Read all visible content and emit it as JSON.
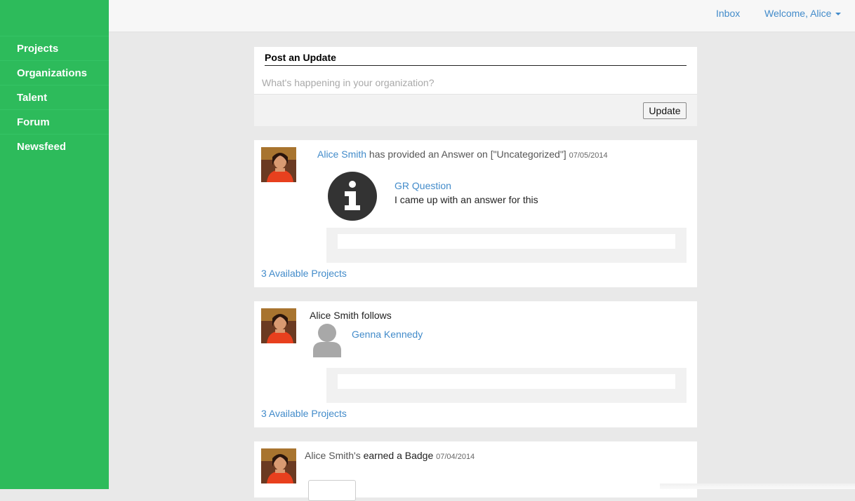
{
  "sidebar": {
    "items": [
      {
        "label": "Projects"
      },
      {
        "label": "Organizations"
      },
      {
        "label": "Talent"
      },
      {
        "label": "Forum"
      },
      {
        "label": "Newsfeed"
      }
    ]
  },
  "topbar": {
    "inbox": "Inbox",
    "welcome": "Welcome, Alice"
  },
  "post": {
    "title": "Post an Update",
    "placeholder": "What's happening in your organization?",
    "button": "Update"
  },
  "feed": [
    {
      "user": "Alice Smith",
      "action": " has provided an Answer on [\"Uncategorized\"]",
      "date": "07/05/2014",
      "question_title": "GR Question",
      "answer_text": "I came up with an answer for this",
      "projects_link": "3 Available Projects"
    },
    {
      "user": "Alice Smith",
      "action": " follows",
      "followed_user": "Genna Kennedy",
      "projects_link": "3 Available Projects"
    },
    {
      "user": "Alice Smith's",
      "action": " earned a Badge",
      "date": "07/04/2014"
    }
  ],
  "colors": {
    "sidebar_bg": "#2dbb5b",
    "link": "#428bca",
    "page_bg": "#e9e9e9"
  },
  "icons": [
    "info-icon",
    "person-icon",
    "caret-down-icon",
    "avatar-photo"
  ]
}
